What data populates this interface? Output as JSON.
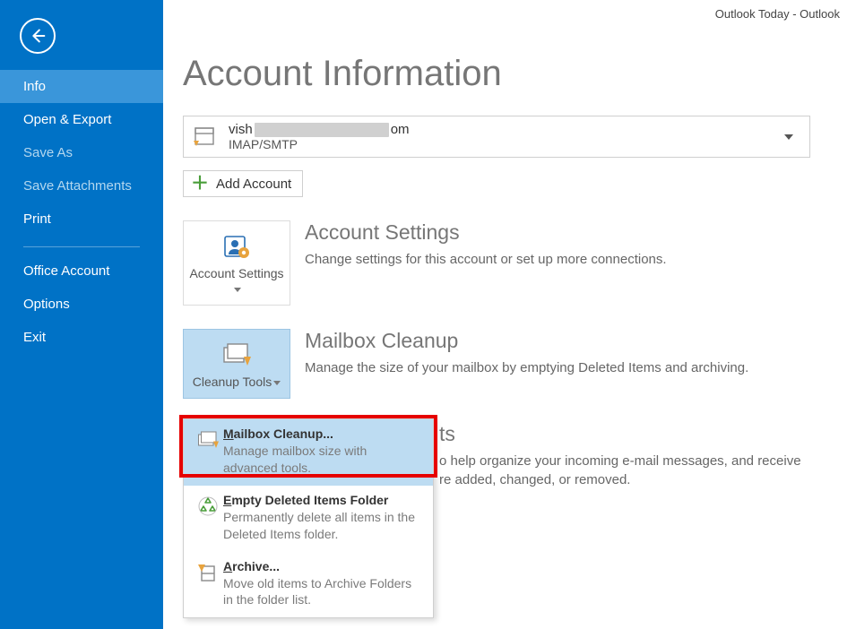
{
  "window": {
    "title": "Outlook Today - Outlook"
  },
  "sidebar": {
    "items": [
      {
        "label": "Info",
        "selected": true
      },
      {
        "label": "Open & Export"
      },
      {
        "label": "Save As",
        "dim": true
      },
      {
        "label": "Save Attachments",
        "dim": true
      },
      {
        "label": "Print"
      }
    ],
    "items2": [
      {
        "label": "Office Account"
      },
      {
        "label": "Options"
      },
      {
        "label": "Exit"
      }
    ]
  },
  "page": {
    "heading": "Account Information"
  },
  "account": {
    "email_prefix": "vish",
    "email_suffix": "om",
    "protocol": "IMAP/SMTP",
    "add_label": "Add Account"
  },
  "sections": {
    "settings": {
      "tile": "Account Settings",
      "heading": "Account Settings",
      "desc": "Change settings for this account or set up more connections."
    },
    "cleanup": {
      "tile": "Cleanup Tools",
      "heading": "Mailbox Cleanup",
      "desc": "Manage the size of your mailbox by emptying Deleted Items and archiving."
    },
    "rules": {
      "heading_fragment": "ts",
      "desc_line1": "o help organize your incoming e-mail messages, and receive",
      "desc_line2": "re added, changed, or removed."
    }
  },
  "menu": {
    "items": [
      {
        "title_pre": "",
        "accel": "M",
        "title_post": "ailbox Cleanup...",
        "desc": "Manage mailbox size with advanced tools."
      },
      {
        "title_pre": "",
        "accel": "E",
        "title_post": "mpty Deleted Items Folder",
        "desc": "Permanently delete all items in the Deleted Items folder."
      },
      {
        "title_pre": "",
        "accel": "A",
        "title_post": "rchive...",
        "desc": "Move old items to Archive Folders in the folder list."
      }
    ]
  }
}
